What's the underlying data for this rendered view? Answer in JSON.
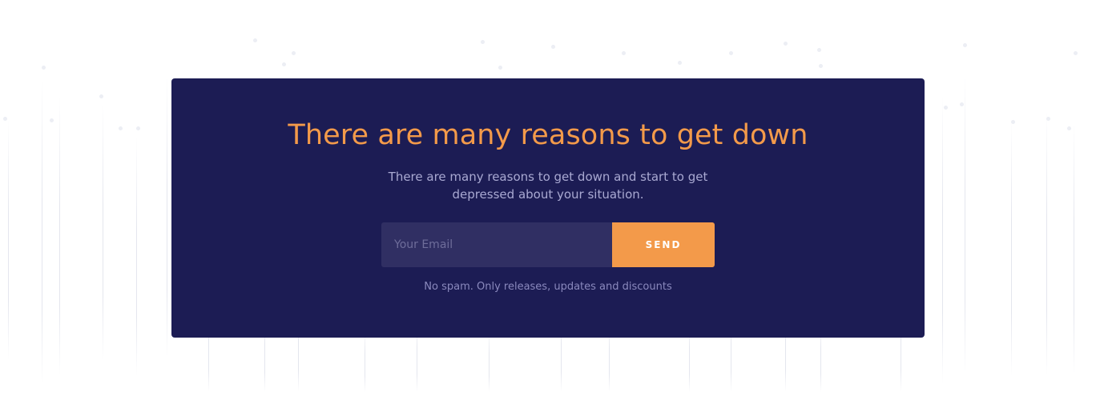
{
  "newsletter": {
    "title": "There are many reasons to get down",
    "subtitle": "There are many reasons to get down and start to get depressed about your situation.",
    "email_placeholder": "Your Email",
    "email_value": "",
    "send_label": "SEND",
    "note": "No spam. Only releases, updates and discounts"
  },
  "colors": {
    "card_background": "#1c1c54",
    "accent": "#f39a4a",
    "input_background": "#302f63",
    "subtitle_text": "#a9a9d2",
    "note_text": "#8a89bd"
  }
}
